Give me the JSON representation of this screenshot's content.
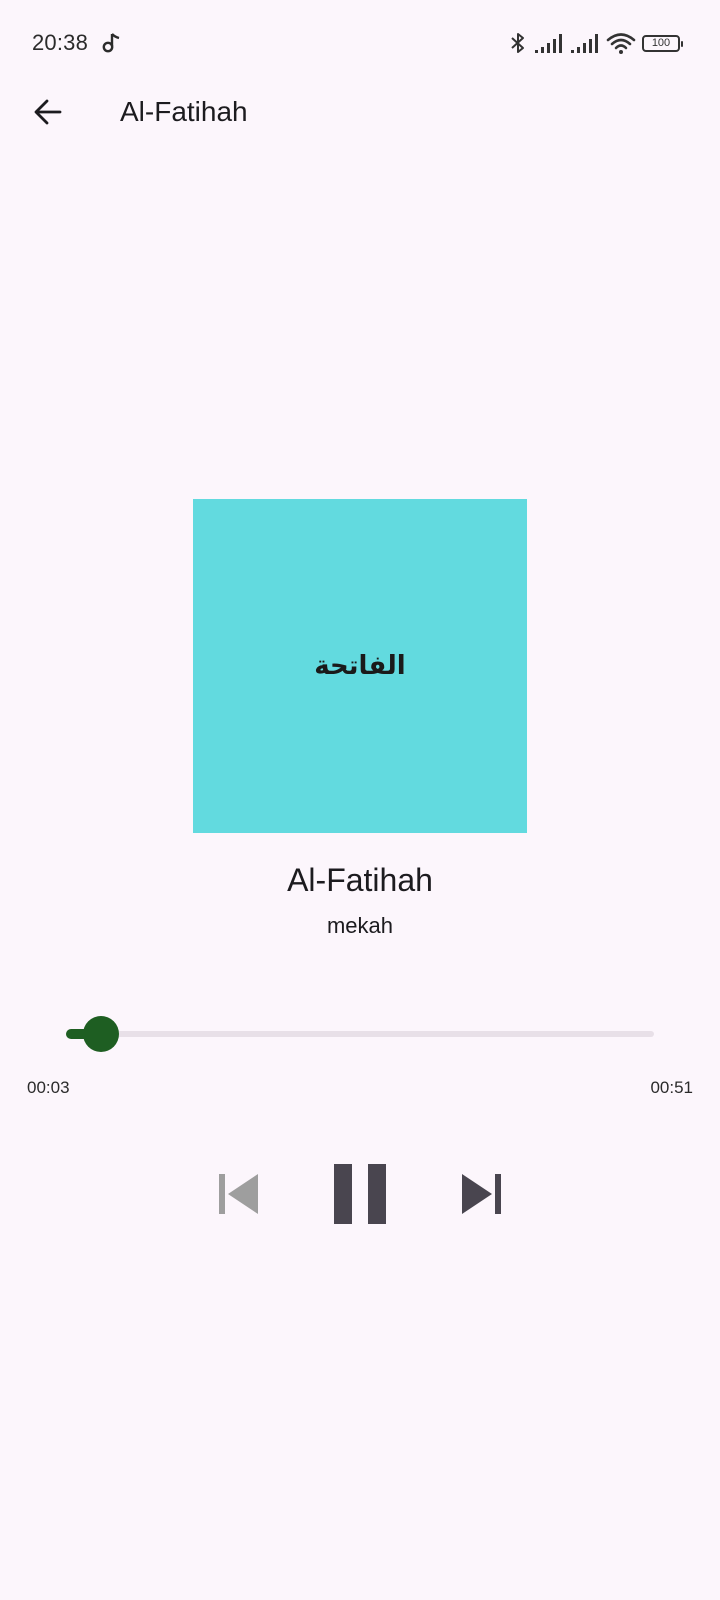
{
  "status_bar": {
    "time": "20:38",
    "battery": "100",
    "icons": [
      "music-note-icon",
      "bluetooth-icon",
      "signal-icon",
      "signal-icon",
      "wifi-icon",
      "battery-icon"
    ]
  },
  "app_bar": {
    "title": "Al-Fatihah",
    "back_icon": "arrow-back-icon"
  },
  "cover": {
    "text": "الفاتحة",
    "color": "#62dadf"
  },
  "track": {
    "title": "Al-Fatihah",
    "artist": "mekah"
  },
  "progress": {
    "current": "00:03",
    "total": "00:51",
    "fraction": 0.06,
    "accent": "#1e5e22"
  },
  "controls": {
    "previous_icon": "skip-previous-icon",
    "pause_icon": "pause-icon",
    "next_icon": "skip-next-icon",
    "previous_enabled": false
  }
}
